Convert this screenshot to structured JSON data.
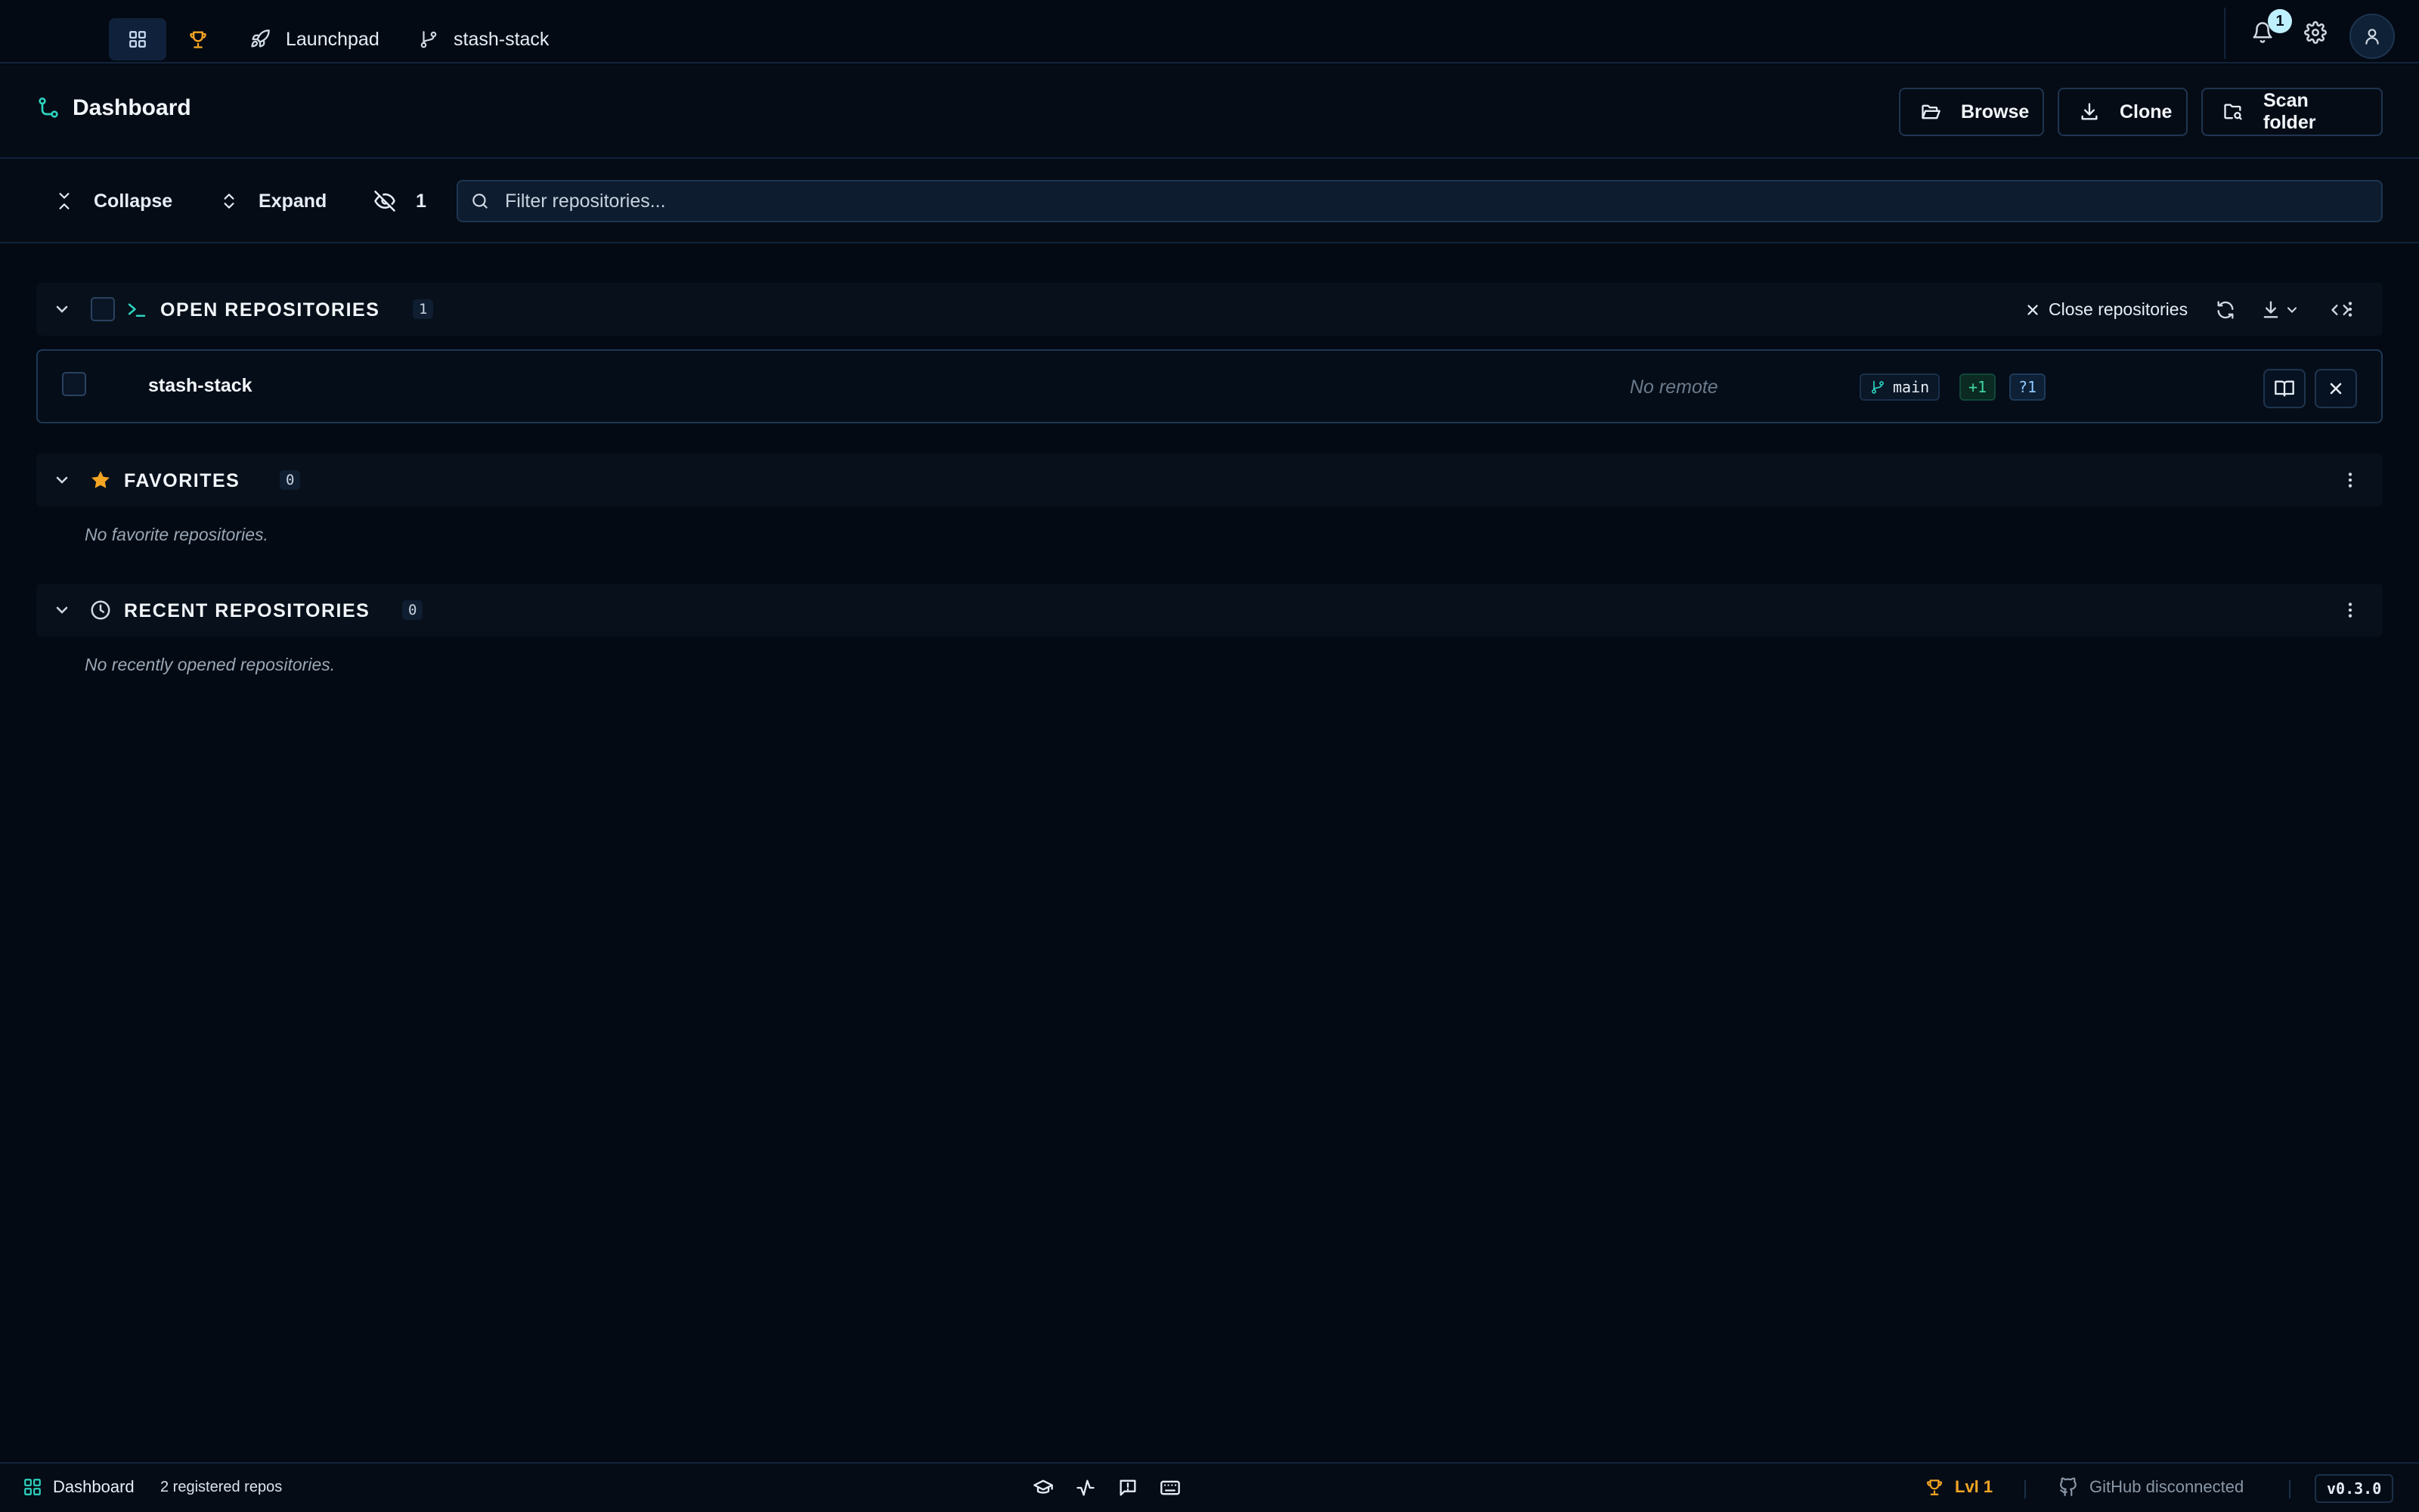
{
  "nav": {
    "tabs": [
      {
        "id": "dashboard",
        "icon": "dashboard-grid-icon"
      },
      {
        "id": "achievements",
        "icon": "trophy-icon"
      },
      {
        "id": "launchpad",
        "label": "Launchpad",
        "icon": "rocket-icon"
      },
      {
        "id": "repo",
        "label": "stash-stack",
        "icon": "git-branch-icon"
      }
    ],
    "notifications_count": "1"
  },
  "header": {
    "title": "Dashboard",
    "actions": {
      "browse": "Browse",
      "clone": "Clone",
      "scan_folder": "Scan folder"
    }
  },
  "toolbar": {
    "collapse": "Collapse",
    "expand": "Expand",
    "hidden_count": "1",
    "search_placeholder": "Filter repositories..."
  },
  "sections": {
    "open": {
      "title": "OPEN REPOSITORIES",
      "count": "1",
      "close_label": "Close repositories",
      "repos": [
        {
          "name": "stash-stack",
          "remote": "No remote",
          "branch": "main",
          "added": "+1",
          "untracked": "?1"
        }
      ]
    },
    "favorites": {
      "title": "FAVORITES",
      "count": "0",
      "empty": "No favorite repositories."
    },
    "recent": {
      "title": "RECENT REPOSITORIES",
      "count": "0",
      "empty": "No recently opened repositories."
    }
  },
  "statusbar": {
    "page": "Dashboard",
    "registered": "2 registered repos",
    "level": "Lvl 1",
    "github": "GitHub disconnected",
    "version": "v0.3.0"
  },
  "colors": {
    "background": "#040a13",
    "accent_teal": "#2dd4bf",
    "accent_gold": "#f5a524",
    "added_green": "#3fd6a0",
    "untracked_blue": "#8fc8ff"
  }
}
